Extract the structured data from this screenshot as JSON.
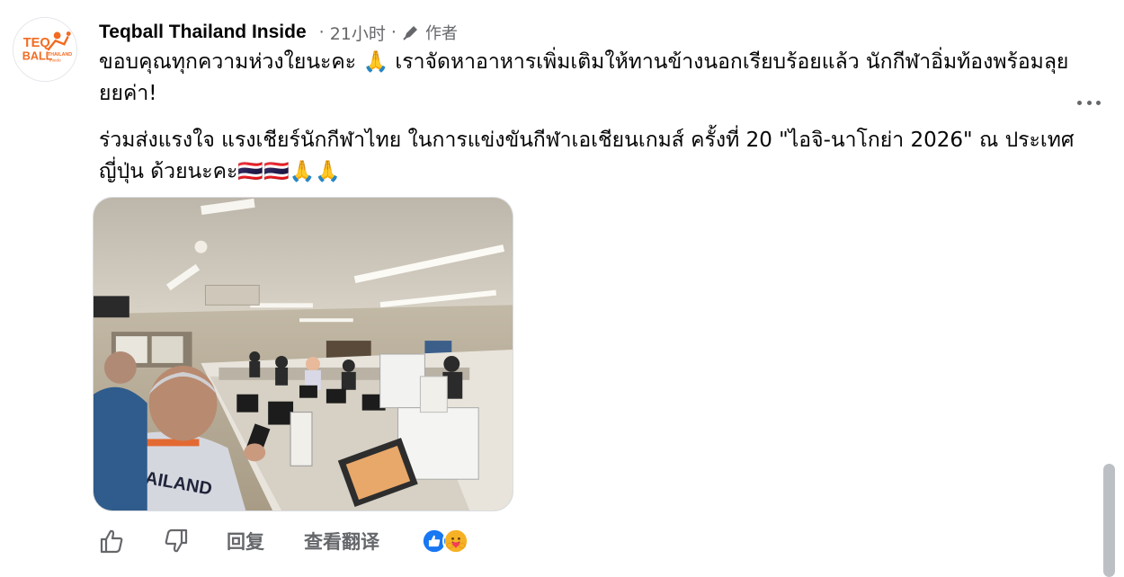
{
  "post": {
    "author": "Teqball Thailand Inside",
    "separator": "·",
    "time": "21小时",
    "role": "作者",
    "line1": "ขอบคุณทุกความห่วงใยนะคะ 🙏 เราจัดหาอาหารเพิ่มเติมให้ทานข้างนอกเรียบร้อยแล้ว นักกีฬาอิ่มท้องพร้อมลุยยยค่า!",
    "line2": "ร่วมส่งแรงใจ แรงเชียร์นักกีฬาไทย ในการแข่งขันกีฬาเอเชียนเกมส์ ครั้งที่ 20 \"ไอจิ-นาโกย่า 2026\" ณ ประเทศญี่ปุ่น ด้วยนะคะ🇹🇭🇹🇭🙏🙏"
  },
  "avatar": {
    "logo_line1": "TEQ",
    "logo_line2": "BALL",
    "logo_line3": "THAILAND",
    "logo_line4": "Inside"
  },
  "photo": {
    "shirt_text": "THAILAND",
    "icon": "restaurant-photo"
  },
  "actions": {
    "like_icon": "thumbs-up-icon",
    "dislike_icon": "thumbs-down-icon",
    "reply": "回复",
    "translate": "查看翻译",
    "reaction_icons": [
      "like-reaction-icon",
      "care-reaction-icon"
    ]
  },
  "colors": {
    "brand_orange": "#f26b21",
    "like_blue": "#1877f2",
    "care_yellow": "#f7b125",
    "muted": "#65676b"
  }
}
